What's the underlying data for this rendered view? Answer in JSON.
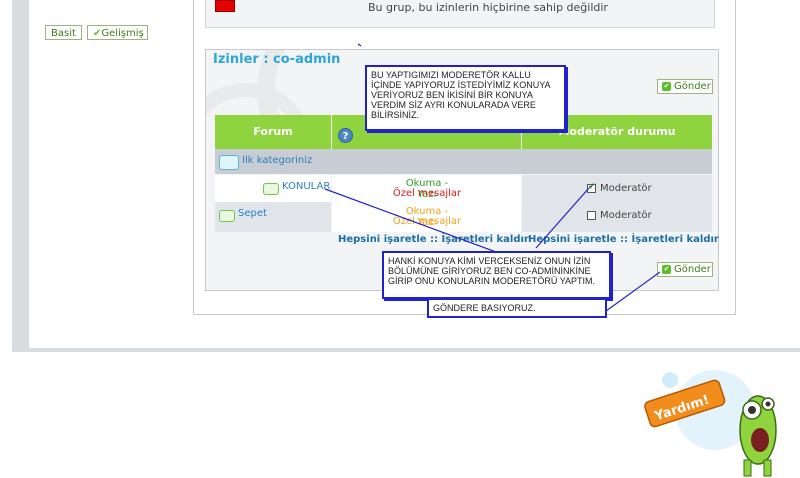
{
  "mode_buttons": {
    "basic": "Basit",
    "advanced": "Gelişmiş"
  },
  "top_note": "Bu grup, bu izinlerin hiçbirine sahip değildir",
  "permissions": {
    "title": "Izinler : co-admin",
    "send_label": "Gönder",
    "headers": {
      "forum": "Forum",
      "help": "?",
      "moderator": "Moderatör durumu"
    },
    "forums": [
      {
        "label": "Ilk kategoriniz"
      },
      {
        "label": "KONULAR"
      },
      {
        "label": "Sepet"
      }
    ],
    "rows": [
      {
        "perm_main": "Okuma - Yazı",
        "perm_sub": "Özel mesajlar",
        "moderator_label": "Moderatör",
        "checked": true
      },
      {
        "perm_main": "Okuma - Yazı",
        "perm_sub": "Özel mesajlar",
        "moderator_label": "Moderatör",
        "checked": false
      }
    ],
    "select_all": "Hepsini işaretle",
    "separator": "::",
    "clear": "İşaretleri kaldır"
  },
  "notes": {
    "note1": "BU YAPTIGIMIZI MODERETÖR KALLU İÇİNDE YAPIYORUZ İSTEDİYİMİZ KONUYA VERİYORUZ BEN İKİSİNİ BİR KONUYA VERDİM SİZ AYRI KONULARADA VERE BİLİRSİNİZ.",
    "note2": "HANKİ KONUYA KİMİ VERCEKSENİZ ONUN İZİN BÖLÜMÜNE GİRİYORUZ BEN CO-ADMİNİNKİNE GİRİP ONU KONULARIN MODERETÖRÜ YAPTIM.",
    "note3": "GÖNDERE BASIYORUZ."
  },
  "mascot": {
    "label": "Yardım!"
  },
  "colors": {
    "accent_green": "#8fd43f",
    "title_blue": "#2aa7d8",
    "annotation_blue": "#2222cc",
    "perm_green": "#2f9d1f",
    "perm_red": "#e01919",
    "perm_orange": "#f0a31c"
  }
}
